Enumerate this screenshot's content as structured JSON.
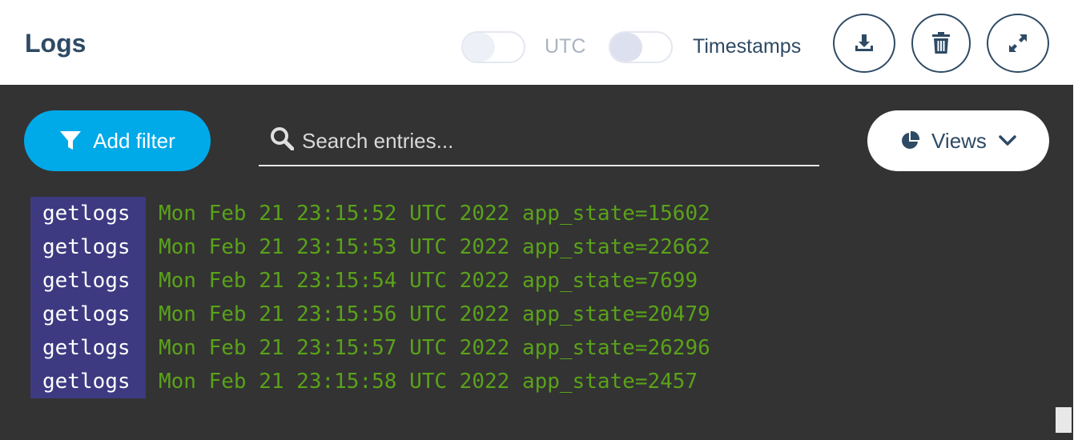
{
  "header": {
    "title": "Logs",
    "utc_label": "UTC",
    "utc_on": false,
    "timestamps_label": "Timestamps",
    "timestamps_on": false
  },
  "toolbar": {
    "add_filter_label": "Add filter",
    "search_placeholder": "Search entries...",
    "views_label": "Views"
  },
  "logs": [
    {
      "pod": "getlogs",
      "message": "Mon Feb 21 23:15:52 UTC 2022 app_state=15602"
    },
    {
      "pod": "getlogs",
      "message": "Mon Feb 21 23:15:53 UTC 2022 app_state=22662"
    },
    {
      "pod": "getlogs",
      "message": "Mon Feb 21 23:15:54 UTC 2022 app_state=7699"
    },
    {
      "pod": "getlogs",
      "message": "Mon Feb 21 23:15:56 UTC 2022 app_state=20479"
    },
    {
      "pod": "getlogs",
      "message": "Mon Feb 21 23:15:57 UTC 2022 app_state=26296"
    },
    {
      "pod": "getlogs",
      "message": "Mon Feb 21 23:15:58 UTC 2022 app_state=2457"
    }
  ],
  "colors": {
    "brand_dark": "#2e4a64",
    "accent": "#00a9e8",
    "console_bg": "#333333",
    "pod_bg": "#3d3a82",
    "log_text": "#5aa21a"
  },
  "icons": {
    "download": "download-icon",
    "trash": "trash-icon",
    "expand": "expand-icon",
    "filter": "filter-icon",
    "search": "search-icon",
    "views": "pie-chart-icon",
    "chevron": "chevron-down-icon"
  }
}
